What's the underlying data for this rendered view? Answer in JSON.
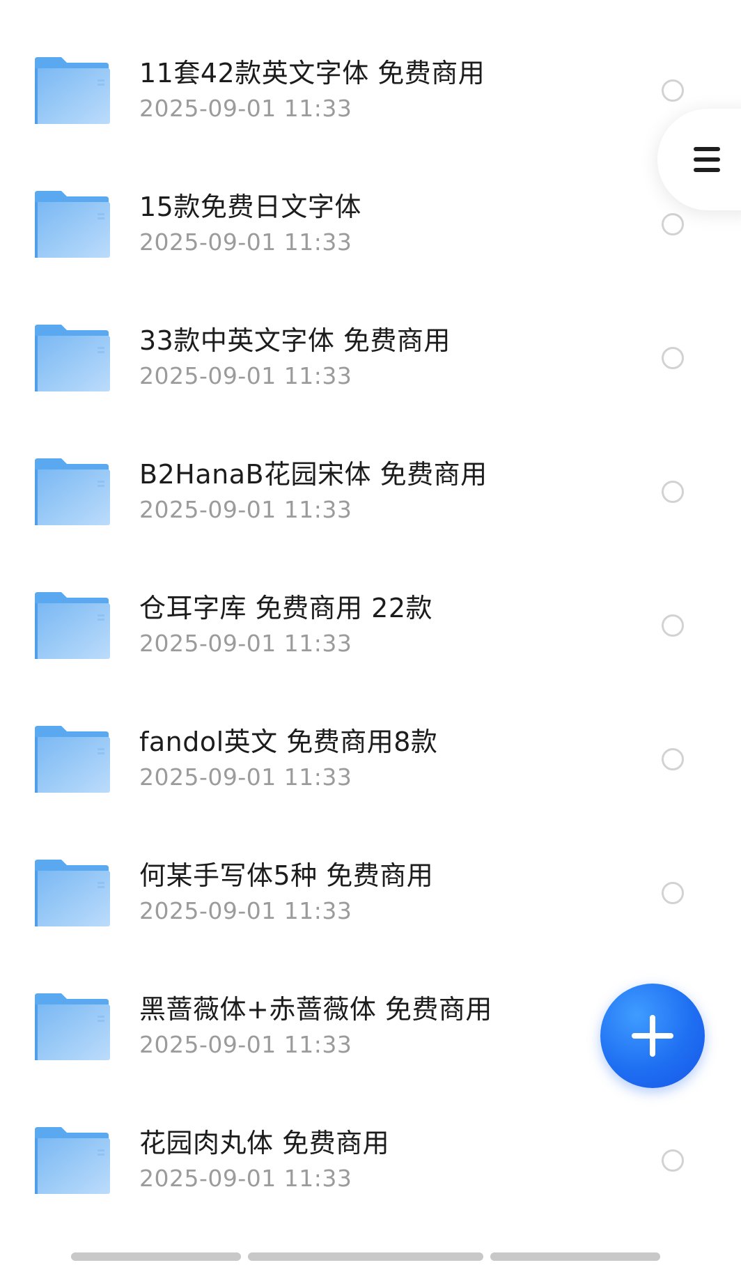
{
  "files": [
    {
      "name": "11套42款英文字体 免费商用",
      "date": "2025-09-01 11:33",
      "icon": "folder-icon"
    },
    {
      "name": "15款免费日文字体",
      "date": "2025-09-01 11:33",
      "icon": "folder-icon"
    },
    {
      "name": "33款中英文字体 免费商用",
      "date": "2025-09-01 11:33",
      "icon": "folder-icon"
    },
    {
      "name": "B2HanaB花园宋体 免费商用",
      "date": "2025-09-01 11:33",
      "icon": "folder-icon"
    },
    {
      "name": "仓耳字库 免费商用 22款",
      "date": "2025-09-01 11:33",
      "icon": "folder-icon"
    },
    {
      "name": "fandol英文 免费商用8款",
      "date": "2025-09-01 11:33",
      "icon": "folder-icon"
    },
    {
      "name": "何某手写体5种 免费商用",
      "date": "2025-09-01 11:33",
      "icon": "folder-icon"
    },
    {
      "name": "黑蔷薇体+赤蔷薇体 免费商用",
      "date": "2025-09-01 11:33",
      "icon": "folder-icon"
    },
    {
      "name": "花园肉丸体 免费商用",
      "date": "2025-09-01 11:33",
      "icon": "folder-icon"
    }
  ],
  "controls": {
    "menu_icon": "hamburger-icon",
    "fab_icon": "plus-icon"
  },
  "colors": {
    "folder_light": "#b3d9ff",
    "folder_dark": "#5aa9f0",
    "fab": "#1f6ff2",
    "date_text": "#9b9b9b",
    "name_text": "#1c1c1c"
  }
}
